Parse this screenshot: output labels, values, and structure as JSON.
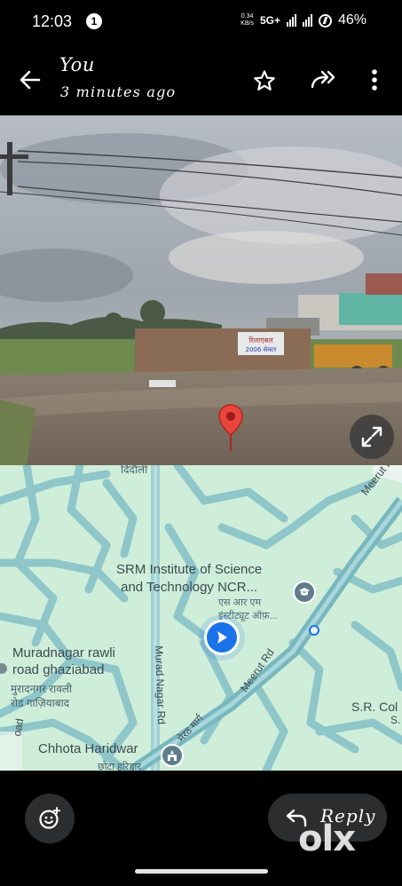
{
  "status_bar": {
    "time": "12:03",
    "notification_count": "1",
    "speed_value": "0.34",
    "speed_unit": "KB/s",
    "network": "5G+",
    "battery": "46%"
  },
  "header": {
    "title": "You",
    "subtitle": "3 minutes ago"
  },
  "photo": {
    "sign_text_line1": "रिलाएबल",
    "sign_text_line2": "2006 सेक्टर"
  },
  "map": {
    "poi_name_line1": "SRM Institute of Science",
    "poi_name_line2": "and Technology NCR...",
    "poi_hindi_line1": "एस आर एम",
    "poi_hindi_line2": "इंस्टीट्यूट ऑफ़...",
    "muradnagar_line1": "Muradnagar rawli",
    "muradnagar_line2": "road ghaziabad",
    "muradnagar_hi_line1": "मुरादनगर रावली",
    "muradnagar_hi_line2": "रोड गाज़ियाबाद",
    "haridwar": "Chhota Haridwar",
    "haridwar_hi": "छोटा हरिद्वार",
    "src": "S.R. Col",
    "src_line2": "S.",
    "didauli": "दिदौली",
    "road_meerut_1": "Meerut Rd",
    "road_meerut_2": "Meerut Rd",
    "road_murad_nagar": "Murad Nagar Rd",
    "road_meerut_hi": "मेरठ मार्ग",
    "road_edge": "oad"
  },
  "bottom_bar": {
    "reply_label": "Reply",
    "watermark": "olx"
  },
  "colors": {
    "background": "#000000",
    "map_land": "#cfeeda",
    "map_roads": "#8ec6c9",
    "pin_red": "#e8453c",
    "location_blue": "#1a73e8",
    "button_bg": "#2b2d2f"
  },
  "icons": [
    "back-arrow-icon",
    "star-icon",
    "forward-icon",
    "more-vertical-icon",
    "expand-icon",
    "map-pin-icon",
    "location-arrow-icon",
    "school-icon",
    "temple-icon",
    "emoji-add-icon",
    "reply-icon"
  ]
}
